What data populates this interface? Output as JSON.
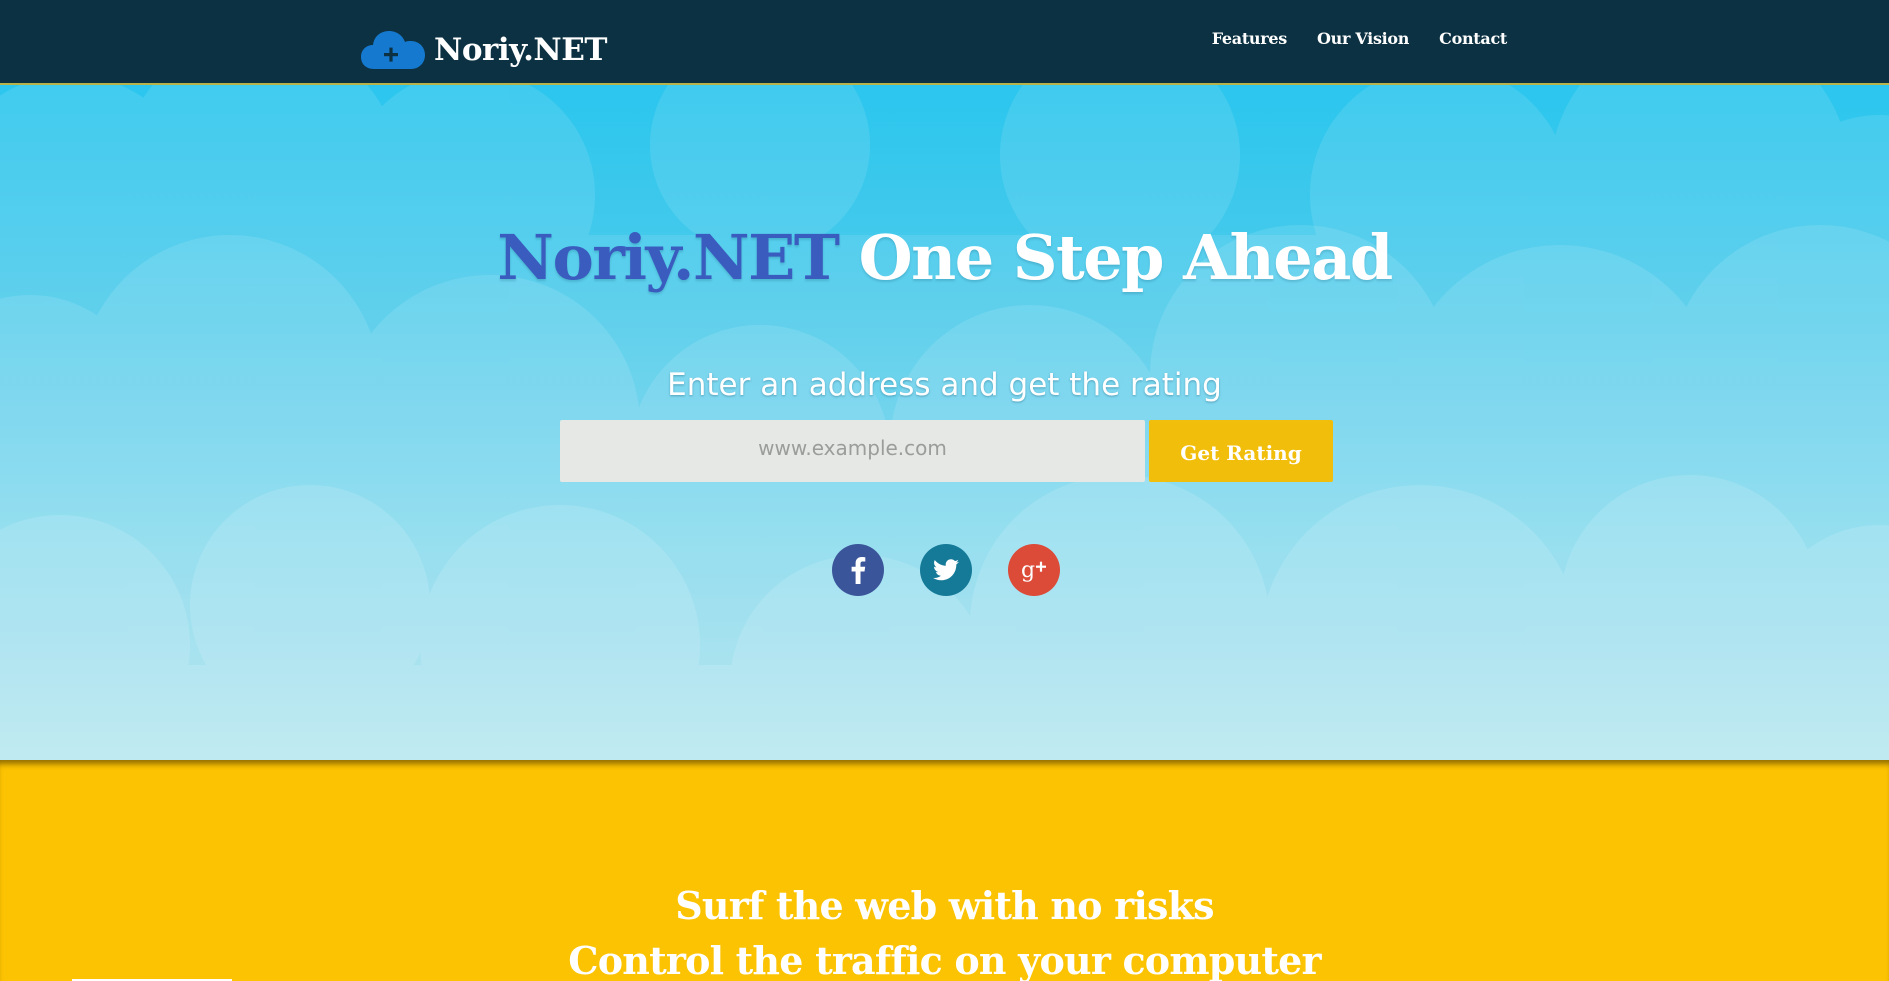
{
  "navbar": {
    "brand_name": "Noriy.NET",
    "brand_icon": "cloud-plus-icon",
    "links": [
      {
        "label": "Features"
      },
      {
        "label": "Our Vision"
      },
      {
        "label": "Contact"
      }
    ]
  },
  "hero": {
    "title_brand": "Noriy.NET",
    "title_rest": " One Step Ahead",
    "subtitle": "Enter an address and get the rating",
    "input_placeholder": "www.example.com",
    "input_value": "",
    "button_label": "Get Rating",
    "social": [
      {
        "icon": "facebook-icon",
        "color": "#3b559a"
      },
      {
        "icon": "twitter-icon",
        "color": "#157a98"
      },
      {
        "icon": "google-plus-icon",
        "color": "#dc4a38"
      }
    ]
  },
  "features": {
    "line_1": "Surf the web with no risks",
    "line_2": "Control the traffic on your computer"
  },
  "colors": {
    "navbar_bg": "#0c3142",
    "title_accent": "#3a5cbf",
    "button_bg": "#f1be0b",
    "section_bg": "#fcc302",
    "sky_top": "#2bc6ee",
    "sky_bottom": "#a6e1ee"
  }
}
